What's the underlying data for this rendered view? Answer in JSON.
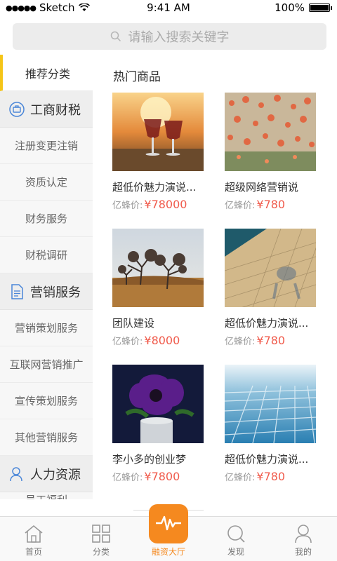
{
  "status_bar": {
    "carrier": "Sketch",
    "time": "9:41 AM",
    "battery": "100%"
  },
  "search": {
    "placeholder": "请输入搜索关键字"
  },
  "sidebar": {
    "recommended": "推荐分类",
    "groups": [
      {
        "title": "工商财税",
        "icon": "briefcase-icon",
        "items": [
          "注册变更注销",
          "资质认定",
          "财务服务",
          "财税调研"
        ]
      },
      {
        "title": "营销服务",
        "icon": "document-icon",
        "items": [
          "营销策划服务",
          "互联网营销推广",
          "宣传策划服务",
          "其他营销服务"
        ]
      },
      {
        "title": "人力资源",
        "icon": "person-icon",
        "items": [
          "员工福利"
        ]
      }
    ]
  },
  "main": {
    "section_title": "热门商品",
    "price_label": "亿蜂价:",
    "products": [
      {
        "name": "超低价魅力演说...",
        "price": "¥78000",
        "image": "wine-glasses-sunset"
      },
      {
        "name": "超级网络营销说",
        "price": "¥780",
        "image": "flower-field"
      },
      {
        "name": "团队建设",
        "price": "¥8000",
        "image": "trees-hillside"
      },
      {
        "name": "超低价魅力演说...",
        "price": "¥780",
        "image": "mosaic-shadow"
      },
      {
        "name": "李小多的创业梦",
        "price": "¥7800",
        "image": "purple-flower"
      },
      {
        "name": "超低价魅力演说...",
        "price": "¥780",
        "image": "blue-tiles"
      }
    ]
  },
  "tabbar": {
    "tabs": [
      {
        "label": "首页",
        "icon": "home-icon"
      },
      {
        "label": "分类",
        "icon": "grid-icon"
      },
      {
        "label": "融资大厅",
        "icon": "pulse-icon"
      },
      {
        "label": "发现",
        "icon": "discover-icon"
      },
      {
        "label": "我的",
        "icon": "user-icon"
      }
    ]
  },
  "colors": {
    "accent": "#f5891f",
    "price": "#f05a4b",
    "active_bar": "#f5c518"
  }
}
